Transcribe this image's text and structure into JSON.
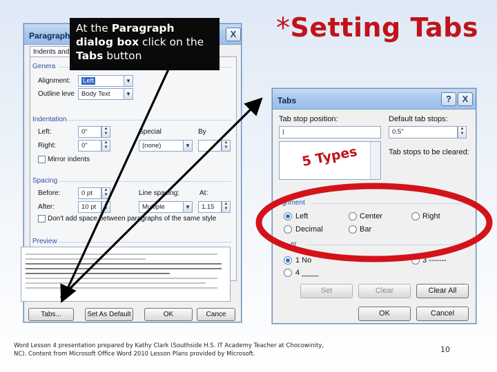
{
  "slide": {
    "title_star": "*",
    "title": "Setting Tabs",
    "callout": {
      "pre": "At the ",
      "bold1": "Paragraph dialog box",
      "mid": " click on the ",
      "bold2": "Tabs",
      "post": " button"
    },
    "annotation": "5 Types",
    "footer": "Word Lesson 4 presentation prepared by Kathy Clark (Southside H.S. IT Academy Teacher at Chocowinity, NC). Content from Microsoft Office Word 2010 Lesson Plans provided by Microsoft.",
    "page_number": "10",
    "colors": {
      "title": "#c0141a",
      "ellipse": "#d4121a",
      "arrow": "#000000"
    }
  },
  "paragraph_dialog": {
    "title": "Paragraph",
    "tab_label": "Indents and S",
    "general_label": "Genera",
    "alignment_label": "Alignment:",
    "alignment_value": "Left",
    "outline_label": "Outline leve",
    "outline_value": "Body Text",
    "indentation_label": "Indentation",
    "left_label": "Left:",
    "left_value": "0\"",
    "right_label": "Right:",
    "right_value": "0\"",
    "special_label": "Special",
    "special_value": "(none)",
    "by_label": "By",
    "mirror_label": "Mirror indents",
    "spacing_label": "Spacing",
    "before_label": "Before:",
    "before_value": "0 pt",
    "after_label": "After:",
    "after_value": "10 pt",
    "line_spacing_label": "Line spacing:",
    "line_spacing_value": "Multiple",
    "at_label": "At:",
    "at_value": "1.15",
    "dont_add_label": "Don't add space between paragraphs of the same style",
    "preview_label": "Preview",
    "buttons": {
      "tabs": "Tabs...",
      "set_default": "Set As Default",
      "ok": "OK",
      "cancel": "Cance"
    },
    "help_icon": "?",
    "close_icon": "X"
  },
  "tabs_dialog": {
    "title": "Tabs",
    "tab_stop_label": "Tab stop position:",
    "tab_stop_value": "|",
    "default_stops_label": "Default tab stops:",
    "default_stops_value": "0.5\"",
    "cleared_label": "Tab stops to be cleared:",
    "alignment_label": "lignment",
    "alignment_options": [
      "Left",
      "Center",
      "Right",
      "Decimal",
      "Bar"
    ],
    "leader_label": "er",
    "leader_options": [
      "1 No",
      "3 -------",
      "4 ____"
    ],
    "buttons": {
      "set": "Set",
      "clear": "Clear",
      "clear_all": "Clear All",
      "ok": "OK",
      "cancel": "Cancel"
    },
    "help_icon": "?",
    "close_icon": "X"
  }
}
